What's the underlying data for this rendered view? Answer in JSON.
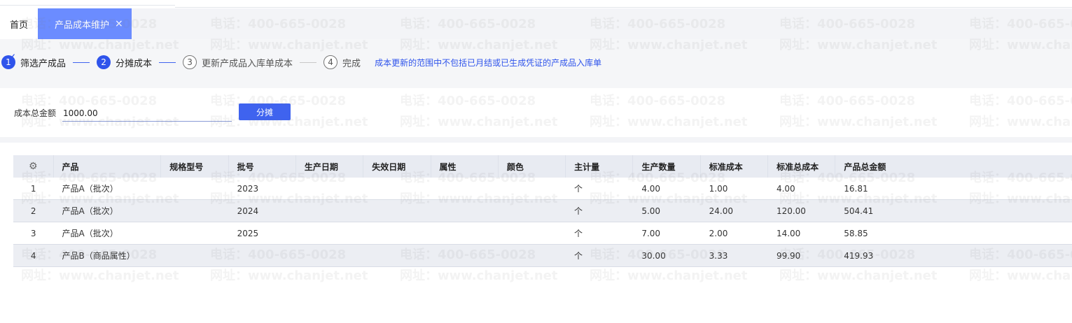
{
  "tabs": {
    "home_label": "首页",
    "active_label": "产品成本维护",
    "close_glyph": "×"
  },
  "steps": [
    {
      "number": "1",
      "label": "筛选产成品",
      "state": "done"
    },
    {
      "number": "2",
      "label": "分摊成本",
      "state": "active"
    },
    {
      "number": "3",
      "label": "更新产成品入库单成本",
      "state": "todo"
    },
    {
      "number": "4",
      "label": "完成",
      "state": "todo"
    }
  ],
  "steps_tip": "成本更新的范围中不包括已月结或已生成凭证的产成品入库单",
  "amount": {
    "label": "成本总金额",
    "value": "1000.00",
    "button_label": "分摊"
  },
  "table": {
    "settings_icon": "gear-icon",
    "columns": [
      "产品",
      "规格型号",
      "批号",
      "生产日期",
      "失效日期",
      "属性",
      "颜色",
      "主计量",
      "生产数量",
      "标准成本",
      "标准总成本",
      "产品总金额"
    ],
    "rows": [
      {
        "idx": "1",
        "cells": [
          "产品A（批次）",
          "",
          "2023",
          "",
          "",
          "",
          "",
          "个",
          "4.00",
          "1.00",
          "4.00",
          "16.81"
        ]
      },
      {
        "idx": "2",
        "cells": [
          "产品A（批次）",
          "",
          "2024",
          "",
          "",
          "",
          "",
          "个",
          "5.00",
          "24.00",
          "120.00",
          "504.41"
        ]
      },
      {
        "idx": "3",
        "cells": [
          "产品A（批次）",
          "",
          "2025",
          "",
          "",
          "",
          "",
          "个",
          "7.00",
          "2.00",
          "14.00",
          "58.85"
        ]
      },
      {
        "idx": "4",
        "cells": [
          "产品B（商品属性）",
          "",
          "",
          "",
          "",
          "",
          "",
          "个",
          "30.00",
          "3.33",
          "99.90",
          "419.93"
        ]
      }
    ]
  },
  "watermark": {
    "phone": "电话：400-665-0028",
    "site": "网址：www.chanjet.net"
  },
  "colors": {
    "accent": "#2f54eb",
    "tab_active": "#6b8cff",
    "button": "#3f63ef"
  }
}
